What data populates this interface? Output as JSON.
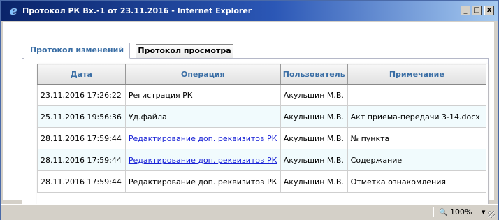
{
  "window": {
    "title": "Протокол РК Вх.-1 от 23.11.2016 - Internet Explorer",
    "minimize": "_",
    "maximize": "□",
    "close": "x"
  },
  "tabs": [
    {
      "label": "Протокол изменений",
      "active": true
    },
    {
      "label": "Протокол просмотра",
      "active": false
    }
  ],
  "table": {
    "headers": [
      "Дата",
      "Операция",
      "Пользователь",
      "Примечание"
    ],
    "rows": [
      {
        "date": "23.11.2016 17:26:22",
        "operation": "Регистрация РК",
        "operation_link": false,
        "user": "Акульшин М.В.",
        "note": ""
      },
      {
        "date": "25.11.2016 19:56:36",
        "operation": "Уд.файла",
        "operation_link": false,
        "user": "Акульшин М.В.",
        "note": "Акт приема-передачи 3-14.docx"
      },
      {
        "date": "28.11.2016 17:59:44",
        "operation": "Редактирование доп. реквизитов РК",
        "operation_link": true,
        "user": "Акульшин М.В.",
        "note": "№ пункта"
      },
      {
        "date": "28.11.2016 17:59:44",
        "operation": "Редактирование доп. реквизитов РК",
        "operation_link": true,
        "user": "Акульшин М.В.",
        "note": "Содержание"
      },
      {
        "date": "28.11.2016 17:59:44",
        "operation": "Редактирование доп. реквизитов РК",
        "operation_link": false,
        "user": "Акульшин М.В.",
        "note": "Отметка ознакомления"
      }
    ]
  },
  "statusbar": {
    "zoom": "100%",
    "zoom_icon": "zoom-icon",
    "dropdown": "▾"
  },
  "colors": {
    "header_text": "#3a6ea5",
    "link": "#1a23d6",
    "alt_row": "#f1fbfd"
  }
}
